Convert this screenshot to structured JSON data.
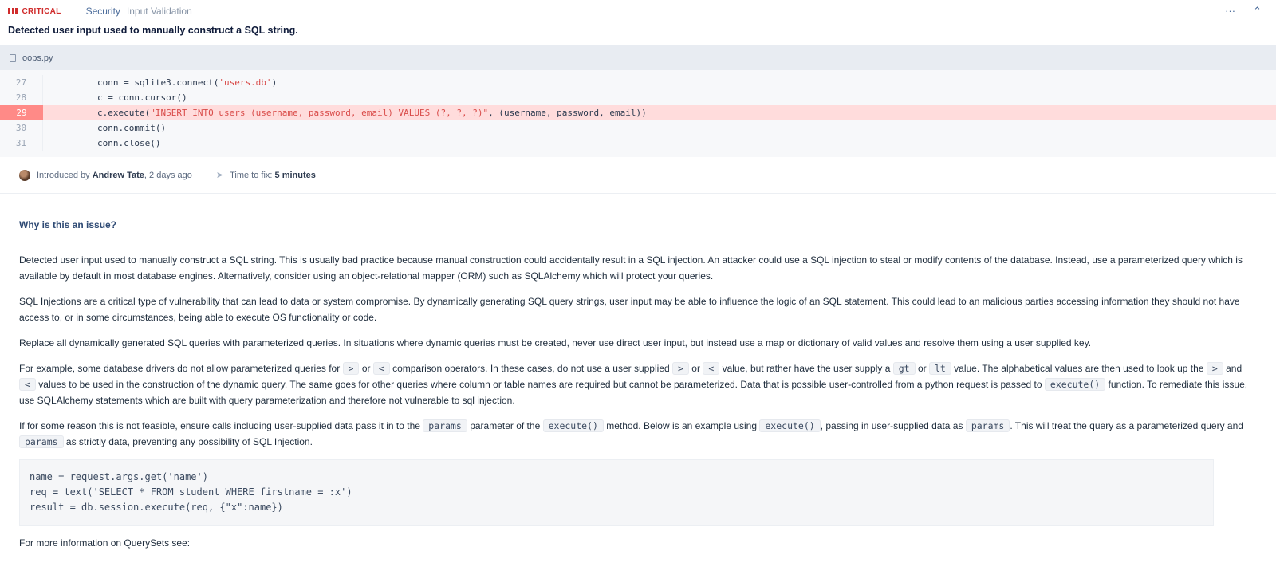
{
  "header": {
    "severity": "CRITICAL",
    "category": "Security",
    "subcategory": "Input Validation",
    "more": "···",
    "collapse": "⌃",
    "title": "Detected user input used to manually construct a SQL string."
  },
  "file": {
    "name": "oops.py"
  },
  "code": [
    {
      "num": "27",
      "pre": "conn = sqlite3.connect(",
      "str": "'users.db'",
      "post": ")"
    },
    {
      "num": "28",
      "pre": "c = conn.cursor()",
      "str": "",
      "post": ""
    },
    {
      "num": "29",
      "pre": "c.execute(",
      "str": "\"INSERT INTO users (username, password, email) VALUES (?, ?, ?)\"",
      "post": ", (username, password, email))"
    },
    {
      "num": "30",
      "pre": "conn.commit()",
      "str": "",
      "post": ""
    },
    {
      "num": "31",
      "pre": "conn.close()",
      "str": "",
      "post": ""
    }
  ],
  "meta": {
    "introduced_prefix": "Introduced by",
    "author": "Andrew Tate",
    "when": ", 2 days ago",
    "time_prefix": "Time to fix:",
    "time_value": "5 minutes"
  },
  "body": {
    "heading": "Why is this an issue?",
    "p1": "Detected user input used to manually construct a SQL string. This is usually bad practice because manual construction could accidentally result in a SQL injection. An attacker could use a SQL injection to steal or modify contents of the database. Instead, use a parameterized query which is available by default in most database engines. Alternatively, consider using an object-relational mapper (ORM) such as SQLAlchemy which will protect your queries.",
    "p2": "SQL Injections are a critical type of vulnerability that can lead to data or system compromise. By dynamically generating SQL query strings, user input may be able to influence the logic of an SQL statement. This could lead to an malicious parties accessing information they should not have access to, or in some circumstances, being able to execute OS functionality or code.",
    "p3": "Replace all dynamically generated SQL queries with parameterized queries. In situations where dynamic queries must be created, never use direct user input, but instead use a map or dictionary of valid values and resolve them using a user supplied key.",
    "p4": {
      "a": "For example, some database drivers do not allow parameterized queries for",
      "gt": ">",
      "or": "or",
      "lt": "<",
      "b": "comparison operators. In these cases, do not use a user supplied",
      "c": "value, but rather have the user supply a",
      "gt_word": "gt",
      "lt_word": "lt",
      "d": "value. The alphabetical values are then used to look up the",
      "and": "and",
      "e": "values to be used in the construction of the dynamic query. The same goes for other queries where column or table names are required but cannot be parameterized. Data that is possible user-controlled from a python request is passed to",
      "execute": "execute()",
      "f": "function. To remediate this issue, use SQLAlchemy statements which are built with query parameterization and therefore not vulnerable to sql injection."
    },
    "p5": {
      "a": "If for some reason this is not feasible, ensure calls including user-supplied data pass it in to the",
      "params": "params",
      "b": "parameter of the",
      "execute": "execute()",
      "c": "method. Below is an example using",
      "d": ", passing in user-supplied data as",
      "e": ". This will treat the query as a parameterized query and",
      "f": "as strictly data, preventing any possibility of SQL Injection."
    },
    "example": "name = request.args.get('name')\nreq = text('SELECT * FROM student WHERE firstname = :x')\nresult = db.session.execute(req, {\"x\":name})",
    "p6": "For more information on QuerySets see:"
  }
}
